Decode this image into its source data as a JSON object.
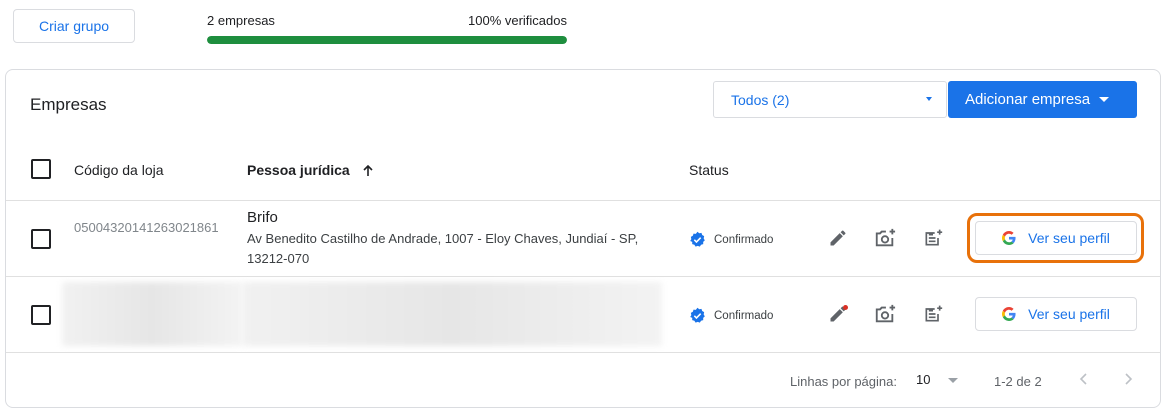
{
  "top": {
    "create_group_label": "Criar grupo",
    "business_count": "2 empresas",
    "verified_pct": "100% verificados",
    "progress": 1.0,
    "progress_color": "#1e8e3e"
  },
  "card": {
    "title": "Empresas",
    "filter_value": "Todos (2)",
    "add_button_label": "Adicionar empresa"
  },
  "table": {
    "columns": {
      "store_code": "Código da loja",
      "legal_entity": "Pessoa jurídica",
      "status": "Status"
    },
    "rows": [
      {
        "store_code": "05004320141263021861",
        "name": "Brifo",
        "address": "Av Benedito Castilho de Andrade, 1007 - Eloy Chaves, Jundiaí - SP, 13212-070",
        "status": "Confirmado",
        "profile_button": "Ver seu perfil"
      },
      {
        "store_code": "",
        "name": "",
        "address": "",
        "status": "Confirmado",
        "profile_button": "Ver seu perfil"
      }
    ]
  },
  "footer": {
    "rows_per_page_label": "Linhas por página:",
    "rows_per_page_value": "10",
    "range": "1-2 de 2"
  },
  "colors": {
    "accent": "#1a73e8",
    "highlight": "#e8710a",
    "verified": "#1a73e8"
  },
  "icons": [
    "sort-up-icon",
    "verified-badge-icon",
    "edit-pencil-icon",
    "add-photo-icon",
    "add-post-icon",
    "google-g-icon",
    "chevron-left-icon",
    "chevron-right-icon",
    "dropdown-caret-icon"
  ]
}
